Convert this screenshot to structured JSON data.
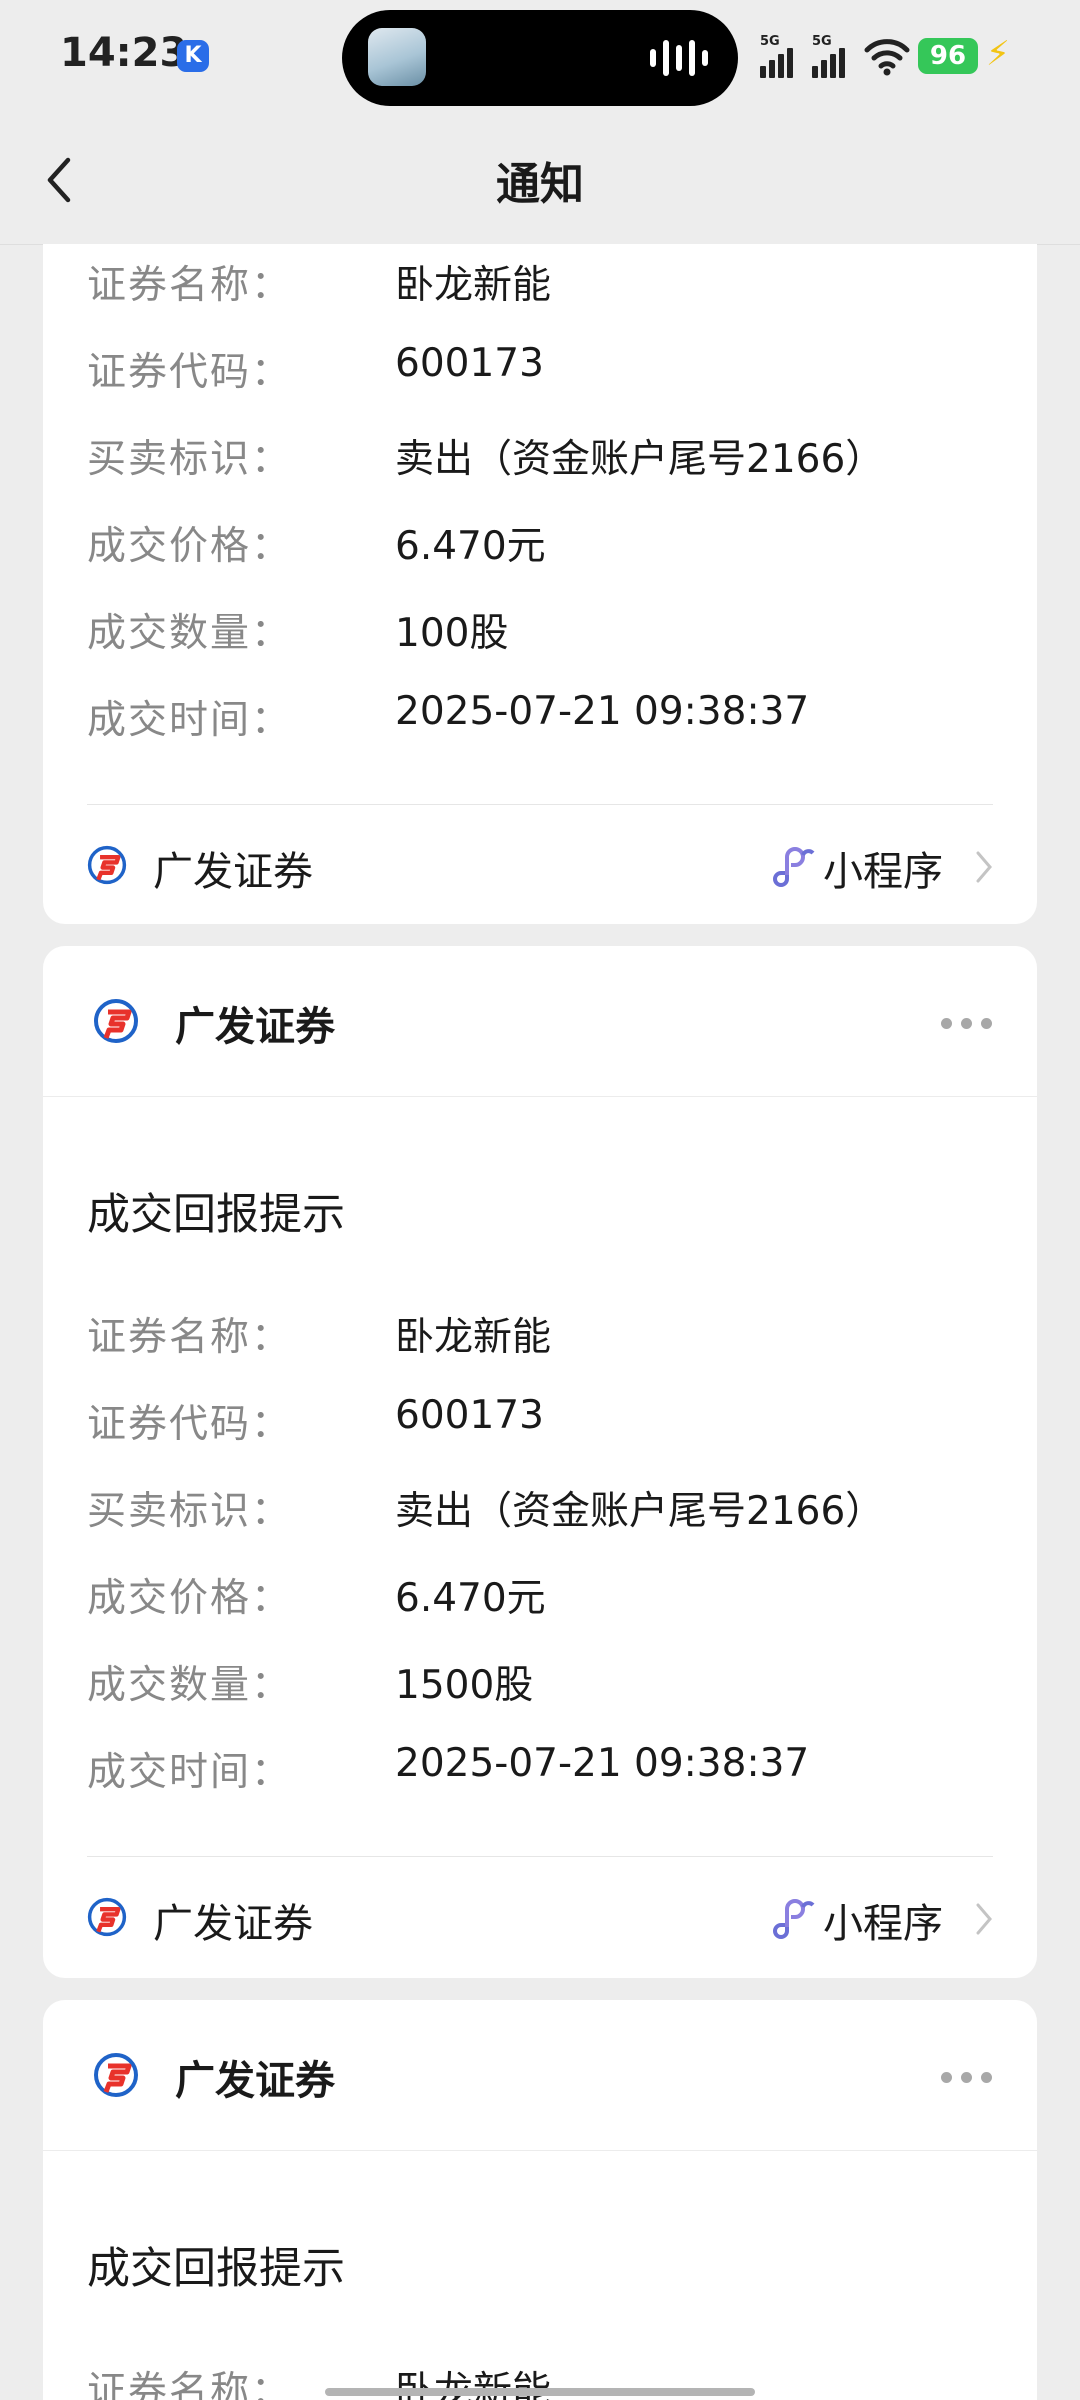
{
  "status": {
    "time": "14:23",
    "k_badge": "K",
    "sim1": "5G",
    "sim2": "5G",
    "battery": "96"
  },
  "nav": {
    "title": "通知"
  },
  "labels": {
    "name": "证券名称：",
    "code": "证券代码：",
    "side": "买卖标识：",
    "price": "成交价格：",
    "qty": "成交数量：",
    "time": "成交时间："
  },
  "cards": [
    {
      "name": "卧龙新能",
      "code": "600173",
      "side": "卖出（资金账户尾号2166）",
      "price": "6.470元",
      "qty": "100股",
      "time": "2025-07-21 09:38:37",
      "footer_name": "广发证券",
      "footer_link": "小程序"
    },
    {
      "header": "广发证券",
      "title": "成交回报提示",
      "name": "卧龙新能",
      "code": "600173",
      "side": "卖出（资金账户尾号2166）",
      "price": "6.470元",
      "qty": "1500股",
      "time": "2025-07-21 09:38:37",
      "footer_name": "广发证券",
      "footer_link": "小程序"
    },
    {
      "header": "广发证券",
      "title": "成交回报提示",
      "name": "卧龙新能"
    }
  ],
  "colors": {
    "brand_red": "#e8322b",
    "brand_blue": "#1f63c8",
    "link_purple": "#6b6fd6",
    "accent_battery": "#35c759"
  }
}
